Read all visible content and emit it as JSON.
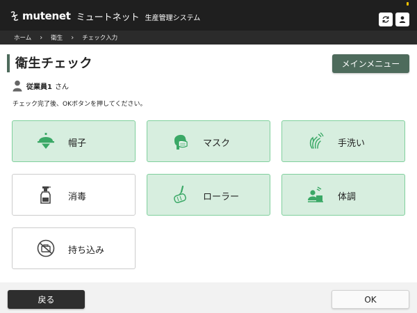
{
  "header": {
    "logo": "mutenet",
    "app_name": "ミュートネット",
    "system_name": "生産管理システム",
    "icons": [
      "refresh-icon",
      "user-icon"
    ],
    "status_color": "#f5c300"
  },
  "breadcrumb": [
    "ホーム",
    "衛生",
    "チェック入力"
  ],
  "page": {
    "title": "衛生チェック",
    "main_menu_label": "メインメニュー",
    "user_name": "従業員1",
    "user_suffix": "さん",
    "instruction": "チェック完了後、OKボタンを押してください。"
  },
  "checks": [
    {
      "label": "帽子",
      "icon": "hat-icon",
      "checked": true
    },
    {
      "label": "マスク",
      "icon": "mask-icon",
      "checked": true
    },
    {
      "label": "手洗い",
      "icon": "handwash-icon",
      "checked": true
    },
    {
      "label": "消毒",
      "icon": "spray-bottle-icon",
      "checked": false
    },
    {
      "label": "ローラー",
      "icon": "lint-roller-icon",
      "checked": true
    },
    {
      "label": "体調",
      "icon": "health-condition-icon",
      "checked": true
    },
    {
      "label": "持ち込み",
      "icon": "no-carry-in-icon",
      "checked": false
    }
  ],
  "footer": {
    "back_label": "戻る",
    "ok_label": "OK"
  },
  "colors": {
    "accent": "#4e6b5c",
    "checked_bg": "#d7eedf",
    "checked_border": "#7fcf9c",
    "icon_green": "#3aa866",
    "header_bg": "#1f1f1f"
  }
}
